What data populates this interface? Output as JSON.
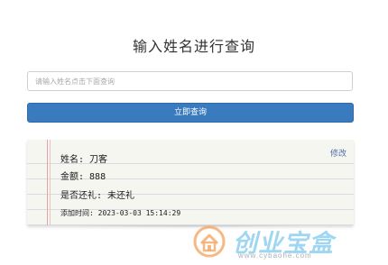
{
  "header": {
    "title": "输入姓名进行查询"
  },
  "search": {
    "placeholder": "请输入姓名点击下面查询",
    "value": ""
  },
  "actions": {
    "query_label": "立即查询"
  },
  "record": {
    "edit_label": "修改",
    "name_line": "姓名: 刀客",
    "amount_line": "金额: 888",
    "returned_line": "是否还礼: 未还礼",
    "time_line": "添加时间: 2023-03-03 15:14:29"
  },
  "watermark": {
    "brand": "创业宝盒",
    "url": "www.cybaohe.com"
  },
  "colors": {
    "primary": "#3a7abf",
    "edit_link": "#4f6fa6",
    "note_bg": "#f6f6f1",
    "watermark_blue": "#8fd0f0",
    "watermark_orange": "#f4a15a"
  }
}
